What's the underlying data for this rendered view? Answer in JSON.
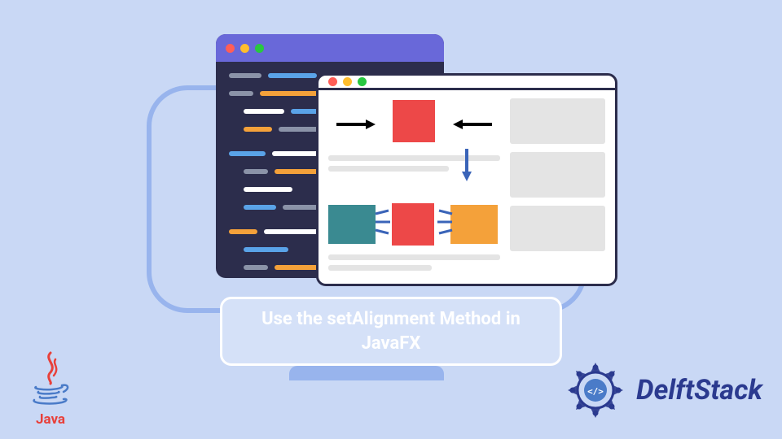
{
  "title": "Use the setAlignment Method in JavaFX",
  "java_logo_label": "Java",
  "delft_logo_label": "DelftStack",
  "colors": {
    "background": "#c9d8f5",
    "monitor_border": "#98b4ed",
    "code_bg": "#2c2d4c",
    "code_titlebar": "#6968d9",
    "red": "#ed4848",
    "teal": "#3a8a91",
    "orange": "#f4a13a",
    "traffic_red": "#ff5e57",
    "traffic_yellow": "#ffbd2e",
    "traffic_green": "#28c840",
    "delft_blue": "#2b3a8f",
    "arrow_blue": "#3a64b8"
  },
  "icons": {
    "java": "java-logo-icon",
    "delft": "delft-mandala-icon",
    "arrow_left": "arrow-left-icon",
    "arrow_right": "arrow-right-icon",
    "arrow_down": "arrow-down-icon"
  }
}
